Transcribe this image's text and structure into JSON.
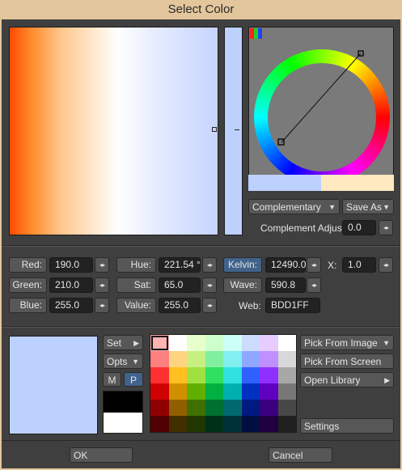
{
  "window": {
    "title": "Select Color"
  },
  "harmony": {
    "mode": "Complementary",
    "save_as": "Save As",
    "complement_adjust_label": "Complement Adjust:",
    "complement_adjust_value": "0.0"
  },
  "rgb": {
    "red_label": "Red:",
    "red_value": "190.0",
    "green_label": "Green:",
    "green_value": "210.0",
    "blue_label": "Blue:",
    "blue_value": "255.0"
  },
  "hsv": {
    "hue_label": "Hue:",
    "hue_value": "221.54 °",
    "sat_label": "Sat:",
    "sat_value": "65.0",
    "value_label": "Value:",
    "value_value": "255.0"
  },
  "temperature": {
    "kelvin_label": "Kelvin:",
    "kelvin_value": "12490.0",
    "x_label": "X:",
    "x_value": "1.0",
    "wave_label": "Wave:",
    "wave_value": "590.8",
    "web_label": "Web:",
    "web_value": "BDD1FF"
  },
  "swatch_tools": {
    "set_label": "Set",
    "opts_label": "Opts",
    "m_label": "M",
    "p_label": "P"
  },
  "actions": {
    "pick_from_image": "Pick From Image",
    "pick_from_screen": "Pick From Screen",
    "open_library": "Open Library",
    "settings": "Settings"
  },
  "footer": {
    "ok": "OK",
    "cancel": "Cancel"
  },
  "colors": {
    "current": "#BDD1FF",
    "complement": "#FFE9C0",
    "accent": "#41638B"
  },
  "palette": [
    [
      "#ffb3b3",
      "#ffffff",
      "#e6ffcc",
      "#ccffcc",
      "#ccfff5",
      "#ccdcff",
      "#e6ccff",
      "#ffffff"
    ],
    [
      "#ff8080",
      "#ffd480",
      "#c8f080",
      "#80f0a0",
      "#80f0f0",
      "#8fa8ff",
      "#c090ff",
      "#d8d8d8"
    ],
    [
      "#ff3030",
      "#ffc020",
      "#a0e040",
      "#30e060",
      "#30e0e0",
      "#3060ff",
      "#9030ff",
      "#a8a8a8"
    ],
    [
      "#d00000",
      "#d09000",
      "#60b000",
      "#00b040",
      "#00b0b0",
      "#0030c0",
      "#6000c0",
      "#787878"
    ],
    [
      "#900000",
      "#906000",
      "#407000",
      "#007030",
      "#006a70",
      "#001a80",
      "#3a0080",
      "#484848"
    ],
    [
      "#500000",
      "#403000",
      "#203800",
      "#003018",
      "#003038",
      "#000e40",
      "#200040",
      "#202020"
    ]
  ]
}
